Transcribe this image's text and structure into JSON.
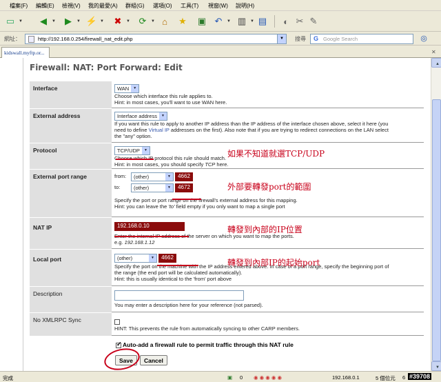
{
  "menu": [
    "檔案(F)",
    "編輯(E)",
    "檢視(V)",
    "我的最愛(A)",
    "群組(G)",
    "選項(O)",
    "工具(T)",
    "視窗(W)",
    "說明(H)"
  ],
  "address": {
    "label": "網址：",
    "url": "http://192.168.0.254/firewall_nat_edit.php"
  },
  "search": {
    "label": "搜尋",
    "placeholder": "Google Search"
  },
  "tab": {
    "title": "kidswall.myftp.or..."
  },
  "page": {
    "title": "Firewall: NAT: Port Forward: Edit"
  },
  "form": {
    "interface": {
      "label": "Interface",
      "value": "WAN",
      "help1": "Choose which interface this rule applies to.",
      "help2": "Hint: in most cases, you'll want to use WAN here."
    },
    "external_address": {
      "label": "External address",
      "value": "Interface address",
      "help1": "If you want this rule to apply to another IP address than the IP address of the interface chosen above, select it here (you",
      "help2a": "need to define ",
      "help2_link": "Virtual IP",
      "help2b": " addresses on the first). Also note that if you are trying to redirect connections on the LAN select",
      "help3": "the \"any\" option."
    },
    "protocol": {
      "label": "Protocol",
      "value": "TCP/UDP",
      "help1": "Choose which IP protocol this rule should match.",
      "help2a": "Hint: in most cases, you should specify ",
      "help2_em": "TCP",
      "help2b": " here."
    },
    "external_port": {
      "label": "External port range",
      "from_label": "from:",
      "to_label": "to:",
      "from_select": "(other)",
      "to_select": "(other)",
      "from_value": "4662",
      "to_value": "4672",
      "help1": "Specify the port or port range on the firewall's external address for this mapping.",
      "help2a": "Hint: you can leave the ",
      "help2_em": "'to'",
      "help2b": " field empty if you only want to map a single port"
    },
    "nat_ip": {
      "label": "NAT IP",
      "value": "192.168.0.10",
      "help1": "Enter the internal IP address of the server on which you want to map the ports.",
      "help2a": "e.g. ",
      "help2_em": "192.168.1.12"
    },
    "local_port": {
      "label": "Local port",
      "select": "(other)",
      "value": "4662",
      "help1": "Specify the port on the machine with the IP address entered above. In case of a port range, specify the beginning port of",
      "help2": "the range (the end port will be calculated automatically).",
      "help3": "Hint: this is usually identical to the 'from' port above"
    },
    "description": {
      "label": "Description",
      "value": "",
      "help": "You may enter a description here for your reference (not parsed)."
    },
    "no_xmlrpc": {
      "label": "No XMLRPC Sync",
      "help": "HINT: This prevents the rule from automatically syncing to other CARP members."
    },
    "auto_add": {
      "label": "Auto-add a firewall rule to permit traffic through this NAT rule",
      "checked": true
    },
    "save_label": "Save",
    "cancel_label": "Cancel"
  },
  "annotations": {
    "protocol": "如果不知道就選TCP/UDP",
    "ext_port": "外部要轉發port的範圍",
    "nat_ip": "轉發到內部的IP位置",
    "local_port": "轉發到內部IP的起始port"
  },
  "status": {
    "done": "完成",
    "count0": "0",
    "ip": "192.168.0.1",
    "items": "5 個位元",
    "num": "6",
    "watermark": "#39708"
  },
  "colors": {
    "annotation": "#c8001a",
    "value_box": "#8b0c0c"
  }
}
